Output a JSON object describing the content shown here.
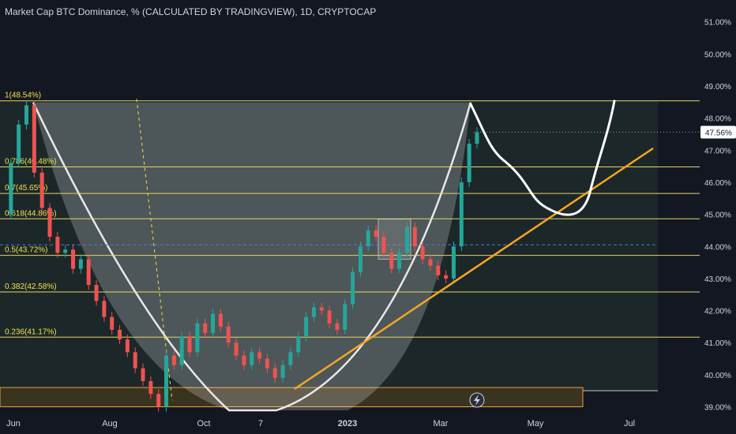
{
  "title": "Market Cap BTC Dominance, % (CALCULATED BY TRADINGVIEW), 1D, CRYPTOCAP",
  "colors": {
    "background": "#131722",
    "text": "#d1d4dc",
    "fib_line": "#e6d56a",
    "fib_label": "#f0e04a",
    "candle_up": "#26a69a",
    "candle_down": "#ef5350",
    "trendline": "#f5a623",
    "cup_fill": "#ffffff",
    "current_badge": "#ffffff",
    "grid": "#1e222d"
  },
  "chart_data": {
    "type": "line",
    "title": "Market Cap BTC Dominance, % (CALCULATED BY TRADINGVIEW), 1D, CRYPTOCAP",
    "x_tick_labels": [
      "Jun",
      "Aug",
      "Oct",
      "7",
      "2023",
      "Mar",
      "May",
      "Jul"
    ],
    "y_tick_labels": [
      "51.00%",
      "50.00%",
      "49.00%",
      "48.00%",
      "47.00%",
      "46.00%",
      "45.00%",
      "44.00%",
      "43.00%",
      "42.00%",
      "41.00%",
      "40.00%",
      "39.00%"
    ],
    "y_ticks": [
      51,
      50,
      49,
      48,
      47,
      46,
      45,
      44,
      43,
      42,
      41,
      40,
      39
    ],
    "ylim": [
      38.9,
      51.6
    ],
    "current_value": 47.56,
    "current_label": "47.56%",
    "fib_levels": [
      {
        "label": "1(48.54%)",
        "value": 48.54
      },
      {
        "label": "0.786(46.48%)",
        "value": 46.48
      },
      {
        "label": "0.7(45.65%)",
        "value": 45.65
      },
      {
        "label": "0.618(44.86%)",
        "value": 44.86
      },
      {
        "label": "0.5(43.72%)",
        "value": 43.72
      },
      {
        "label": "0.382(42.58%)",
        "value": 42.58
      },
      {
        "label": "0.236(41.17%)",
        "value": 41.17
      }
    ],
    "dashed_level": 44.05,
    "series": [
      {
        "values": [
          45.0,
          46.6,
          47.8,
          48.4,
          46.3,
          45.2,
          44.3,
          43.8,
          43.9,
          43.3,
          43.6,
          42.8,
          42.3,
          41.8,
          41.4,
          41.1,
          40.7,
          40.2,
          39.8,
          39.4,
          39.0,
          40.6,
          40.3,
          41.2,
          40.7,
          41.6,
          41.3,
          41.9,
          41.5,
          41.0,
          40.6,
          40.3,
          40.7,
          40.5,
          40.2,
          39.9,
          40.3,
          40.7,
          41.2,
          41.8,
          42.1,
          42.0,
          41.6,
          41.4,
          42.2,
          43.2,
          44.0,
          44.5,
          44.3,
          43.8,
          43.3,
          43.8,
          44.6,
          44.0,
          43.6,
          43.4,
          43.1,
          43.0,
          44.0,
          46.0,
          47.2,
          47.56
        ]
      }
    ]
  }
}
